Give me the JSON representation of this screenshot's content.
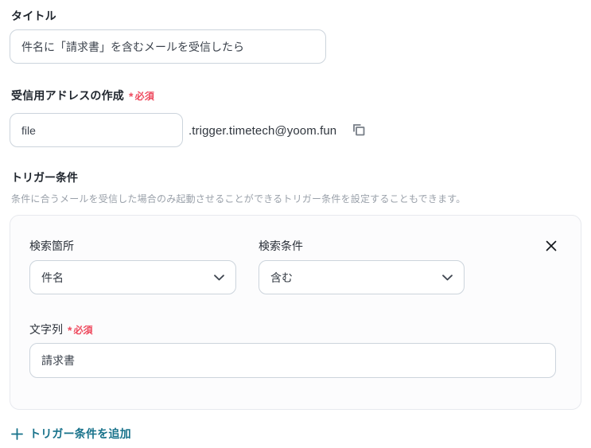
{
  "colors": {
    "accent_teal": "#16718a",
    "required_red": "#ee4a5e",
    "input_border": "#ccd4dc",
    "card_border": "#e7e9ee"
  },
  "title_field": {
    "label": "タイトル",
    "value": "件名に「請求書」を含むメールを受信したら"
  },
  "address_field": {
    "label": "受信用アドレスの作成",
    "required_mark": "*",
    "required_label": "必須",
    "value": "file",
    "domain_suffix": ".trigger.timetech@yoom.fun",
    "copy_icon": "copy-icon"
  },
  "trigger_section": {
    "heading": "トリガー条件",
    "description": "条件に合うメールを受信した場合のみ起動させることができるトリガー条件を設定することもできます。",
    "condition_card": {
      "search_location": {
        "label": "検索箇所",
        "value": "件名"
      },
      "search_condition": {
        "label": "検索条件",
        "value": "含む"
      },
      "string_field": {
        "label": "文字列",
        "required_mark": "*",
        "required_label": "必須",
        "value": "請求書"
      }
    },
    "add_link_label": "トリガー条件を追加"
  }
}
